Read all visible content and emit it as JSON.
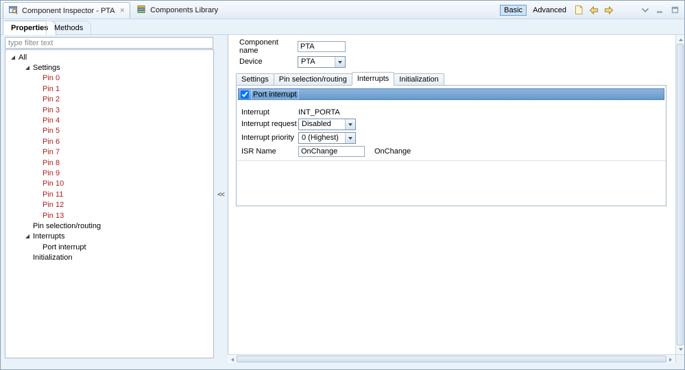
{
  "editor_tabs": [
    {
      "label": "Component Inspector - PTA",
      "icon": "component-inspector-icon",
      "closable": true
    },
    {
      "label": "Components Library",
      "icon": "components-library-icon",
      "closable": false
    }
  ],
  "toolbar": {
    "basic": "Basic",
    "advanced": "Advanced",
    "icons": [
      "new-note-icon",
      "back-arrow-icon",
      "forward-arrow-icon",
      "view-menu-icon",
      "minimize-icon",
      "maximize-icon"
    ]
  },
  "icons": {
    "close": "✕"
  },
  "view_tabs": {
    "properties": "Properties",
    "methods": "Methods"
  },
  "filter": {
    "placeholder": "type filter text"
  },
  "tree": {
    "items": [
      {
        "label": "All",
        "level": 0,
        "expanded": true
      },
      {
        "label": "Settings",
        "level": 1,
        "expanded": true
      },
      {
        "label": "Pin 0",
        "level": 2,
        "red": true
      },
      {
        "label": "Pin 1",
        "level": 2,
        "red": true
      },
      {
        "label": "Pin 2",
        "level": 2,
        "red": true
      },
      {
        "label": "Pin 3",
        "level": 2,
        "red": true
      },
      {
        "label": "Pin 4",
        "level": 2,
        "red": true
      },
      {
        "label": "Pin 5",
        "level": 2,
        "red": true
      },
      {
        "label": "Pin 6",
        "level": 2,
        "red": true
      },
      {
        "label": "Pin 7",
        "level": 2,
        "red": true
      },
      {
        "label": "Pin 8",
        "level": 2,
        "red": true
      },
      {
        "label": "Pin 9",
        "level": 2,
        "red": true
      },
      {
        "label": "Pin 10",
        "level": 2,
        "red": true
      },
      {
        "label": "Pin 11",
        "level": 2,
        "red": true
      },
      {
        "label": "Pin 12",
        "level": 2,
        "red": true
      },
      {
        "label": "Pin 13",
        "level": 2,
        "red": true
      },
      {
        "label": "Pin selection/routing",
        "level": 1
      },
      {
        "label": "Interrupts",
        "level": 1,
        "expanded": true
      },
      {
        "label": "Port interrupt",
        "level": 2
      },
      {
        "label": "Initialization",
        "level": 1
      }
    ]
  },
  "splitter": {
    "collapse": "<<"
  },
  "inspector": {
    "component_name_label": "Component name",
    "component_name_value": "PTA",
    "device_label": "Device",
    "device_value": "PTA",
    "tabs": [
      {
        "label": "Settings"
      },
      {
        "label": "Pin selection/routing"
      },
      {
        "label": "Interrupts",
        "active": true
      },
      {
        "label": "Initialization"
      }
    ],
    "port_interrupt_label": "Port interrupt",
    "port_interrupt_checked": true,
    "rows": [
      {
        "label": "Interrupt",
        "value": "INT_PORTA",
        "type": "text"
      },
      {
        "label": "Interrupt request",
        "value": "Disabled",
        "type": "select"
      },
      {
        "label": "Interrupt priority",
        "value": "0 (Highest)",
        "type": "select"
      },
      {
        "label": "ISR Name",
        "value": "OnChange",
        "type": "input",
        "note": "OnChange"
      }
    ]
  },
  "colors": {
    "selection_blue": "#6699cc",
    "pin_text_red": "#b01c1c",
    "basic_button_highlight": "#cde3f7",
    "chrome": "#e9f1f9"
  }
}
